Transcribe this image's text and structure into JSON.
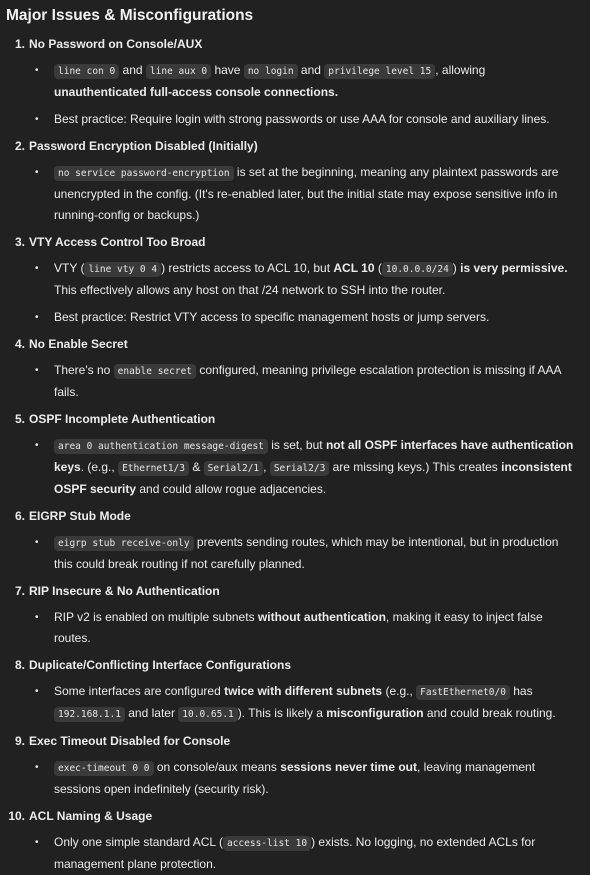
{
  "heading": "Major Issues & Misconfigurations",
  "issues": [
    {
      "num": "1.",
      "title": "No Password on Console/AUX",
      "bullets": [
        [
          {
            "c": "line con 0"
          },
          {
            "t": " and "
          },
          {
            "c": "line aux 0"
          },
          {
            "t": " have "
          },
          {
            "c": "no login"
          },
          {
            "t": " and "
          },
          {
            "c": "privilege level 15"
          },
          {
            "t": ", allowing "
          },
          {
            "b": "unauthenticated full-access console connections."
          }
        ],
        [
          {
            "t": "Best practice: Require login with strong passwords or use AAA for console and auxiliary lines."
          }
        ]
      ]
    },
    {
      "num": "2.",
      "title": "Password Encryption Disabled (Initially)",
      "bullets": [
        [
          {
            "c": "no service password-encryption"
          },
          {
            "t": " is set at the beginning, meaning any plaintext passwords are unencrypted in the config. (It's re-enabled later, but the initial state may expose sensitive info in running-config or backups.)"
          }
        ]
      ]
    },
    {
      "num": "3.",
      "title": "VTY Access Control Too Broad",
      "bullets": [
        [
          {
            "t": "VTY ("
          },
          {
            "c": "line vty 0 4"
          },
          {
            "t": ") restricts access to ACL 10, but "
          },
          {
            "b": "ACL 10"
          },
          {
            "t": " ("
          },
          {
            "c": "10.0.0.0/24"
          },
          {
            "t": ") "
          },
          {
            "b": "is very permissive."
          },
          {
            "t": " This effectively allows any host on that /24 network to SSH into the router."
          }
        ],
        [
          {
            "t": "Best practice: Restrict VTY access to specific management hosts or jump servers."
          }
        ]
      ]
    },
    {
      "num": "4.",
      "title": "No Enable Secret",
      "bullets": [
        [
          {
            "t": "There's no "
          },
          {
            "c": "enable secret"
          },
          {
            "t": " configured, meaning privilege escalation protection is missing if AAA fails."
          }
        ]
      ]
    },
    {
      "num": "5.",
      "title": "OSPF Incomplete Authentication",
      "bullets": [
        [
          {
            "c": "area 0 authentication message-digest"
          },
          {
            "t": " is set, but "
          },
          {
            "b": "not all OSPF interfaces have authentication keys"
          },
          {
            "t": ". (e.g., "
          },
          {
            "c": "Ethernet1/3"
          },
          {
            "t": " & "
          },
          {
            "c": "Serial2/1"
          },
          {
            "t": ", "
          },
          {
            "c": "Serial2/3"
          },
          {
            "t": " are missing keys.) This creates "
          },
          {
            "b": "inconsistent OSPF security"
          },
          {
            "t": " and could allow rogue adjacencies."
          }
        ]
      ]
    },
    {
      "num": "6.",
      "title": "EIGRP Stub Mode",
      "bullets": [
        [
          {
            "c": "eigrp stub receive-only"
          },
          {
            "t": " prevents sending routes, which may be intentional, but in production this could break routing if not carefully planned."
          }
        ]
      ]
    },
    {
      "num": "7.",
      "title": "RIP Insecure & No Authentication",
      "bullets": [
        [
          {
            "t": "RIP v2 is enabled on multiple subnets "
          },
          {
            "b": "without authentication"
          },
          {
            "t": ", making it easy to inject false routes."
          }
        ]
      ]
    },
    {
      "num": "8.",
      "title": "Duplicate/Conflicting Interface Configurations",
      "bullets": [
        [
          {
            "t": "Some interfaces are configured "
          },
          {
            "b": "twice with different subnets"
          },
          {
            "t": " (e.g., "
          },
          {
            "c": "FastEthernet0/0"
          },
          {
            "t": " has "
          },
          {
            "c": "192.168.1.1"
          },
          {
            "t": " and later "
          },
          {
            "c": "10.0.65.1"
          },
          {
            "t": "). This is likely a "
          },
          {
            "b": "misconfiguration"
          },
          {
            "t": " and could break routing."
          }
        ]
      ]
    },
    {
      "num": "9.",
      "title": "Exec Timeout Disabled for Console",
      "bullets": [
        [
          {
            "c": "exec-timeout 0 0"
          },
          {
            "t": " on console/aux means "
          },
          {
            "b": "sessions never time out"
          },
          {
            "t": ", leaving management sessions open indefinitely (security risk)."
          }
        ]
      ]
    },
    {
      "num": "10.",
      "title": "ACL Naming & Usage",
      "bullets": [
        [
          {
            "t": "Only one simple standard ACL ("
          },
          {
            "c": "access-list 10"
          },
          {
            "t": ") exists. No logging, no extended ACLs for management plane protection."
          }
        ]
      ]
    }
  ]
}
